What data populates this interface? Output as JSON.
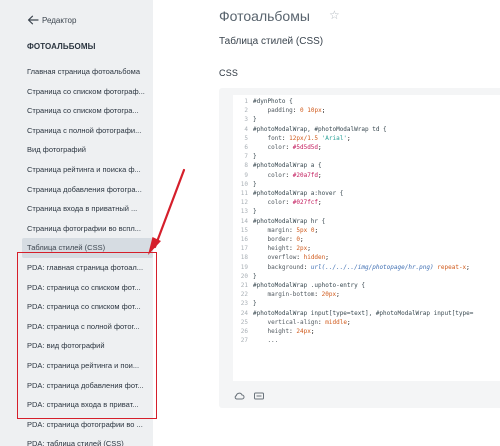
{
  "sidebar": {
    "back_label": "Редактор",
    "section_title": "ФОТОАЛЬБОМЫ",
    "items": [
      {
        "label": "Главная страница фотоальбома",
        "active": false
      },
      {
        "label": "Страница со списком фотограф...",
        "active": false
      },
      {
        "label": "Страница со списком фотогра...",
        "active": false
      },
      {
        "label": "Страница с полной фотографи...",
        "active": false
      },
      {
        "label": "Вид фотографий",
        "active": false
      },
      {
        "label": "Страница рейтинга и поиска ф...",
        "active": false
      },
      {
        "label": "Страница добавления фотогра...",
        "active": false
      },
      {
        "label": "Страница входа в приватный ...",
        "active": false
      },
      {
        "label": "Страница фотографии во вспл...",
        "active": false
      },
      {
        "label": "Таблица стилей (CSS)",
        "active": true
      },
      {
        "label": "PDA: главная страница фотоал...",
        "active": false
      },
      {
        "label": "PDA: страница со списком фот...",
        "active": false
      },
      {
        "label": "PDA: страница со списком фот...",
        "active": false
      },
      {
        "label": "PDA: страница с полной фотог...",
        "active": false
      },
      {
        "label": "PDA: вид фотографий",
        "active": false
      },
      {
        "label": "PDA: страница рейтинга и пои...",
        "active": false
      },
      {
        "label": "PDA: страница добавления фот...",
        "active": false
      },
      {
        "label": "PDA: страница входа в приват...",
        "active": false
      },
      {
        "label": "PDA: страница фотографии во ...",
        "active": false
      },
      {
        "label": "PDA: таблица стилей (CSS)",
        "active": false
      }
    ]
  },
  "main": {
    "title": "Фотоальбомы",
    "subtitle": "Таблица стилей (CSS)",
    "section_label": "CSS"
  },
  "code_lines": [
    {
      "n": "1",
      "t": "#dynPhoto {"
    },
    {
      "n": "2",
      "t": "    padding: 0 10px;"
    },
    {
      "n": "3",
      "t": "}"
    },
    {
      "n": "4",
      "t": "#photoModalWrap, #photoModalWrap td {"
    },
    {
      "n": "5",
      "t": "    font: 12px/1.5 'Arial';"
    },
    {
      "n": "6",
      "t": "    color: #5d5d5d;"
    },
    {
      "n": "7",
      "t": "}"
    },
    {
      "n": "8",
      "t": "#photoModalWrap a {"
    },
    {
      "n": "9",
      "t": "    color: #20a7fd;"
    },
    {
      "n": "10",
      "t": "}"
    },
    {
      "n": "11",
      "t": "#photoModalWrap a:hover {"
    },
    {
      "n": "12",
      "t": "    color: #027fcf;"
    },
    {
      "n": "13",
      "t": "}"
    },
    {
      "n": "14",
      "t": "#photoModalWrap hr {"
    },
    {
      "n": "15",
      "t": "    margin: 5px 0;"
    },
    {
      "n": "16",
      "t": "    border: 0;"
    },
    {
      "n": "17",
      "t": "    height: 2px;"
    },
    {
      "n": "18",
      "t": "    overflow: hidden;"
    },
    {
      "n": "19",
      "t": "    background: url(../../../img/photopage/hr.png) repeat-x;"
    },
    {
      "n": "20",
      "t": "}"
    },
    {
      "n": "21",
      "t": "#photoModalWrap .uphoto-entry {"
    },
    {
      "n": "22",
      "t": "    margin-bottom: 20px;"
    },
    {
      "n": "23",
      "t": "}"
    },
    {
      "n": "24",
      "t": "#photoModalWrap input[type=text], #photoModalWrap input[type="
    },
    {
      "n": "25",
      "t": "    vertical-align: middle;"
    },
    {
      "n": "26",
      "t": "    height: 24px;"
    },
    {
      "n": "27",
      "t": "    ..."
    }
  ],
  "colors": {
    "highlight_box": "#d51f2b",
    "sidebar_bg": "#eef0f2",
    "active_item_bg": "#d6dce2"
  },
  "icons": [
    "back-arrow-icon",
    "star-icon",
    "cloud-icon",
    "code-block-icon"
  ]
}
